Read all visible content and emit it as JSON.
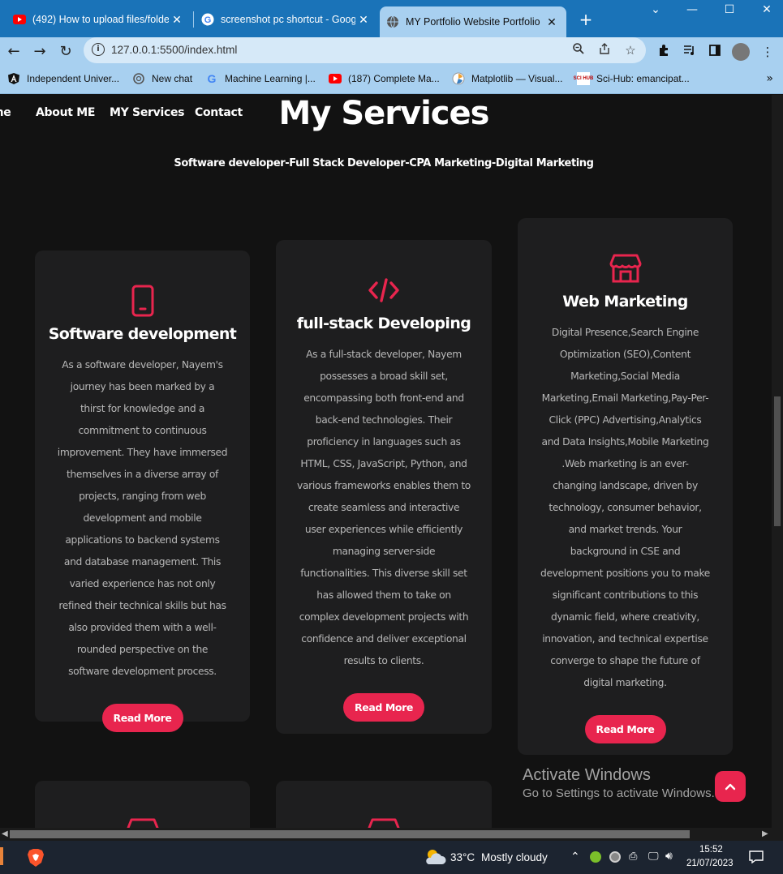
{
  "browser": {
    "tabs": [
      {
        "title": "(492) How to upload files/folder",
        "icon": "youtube-icon"
      },
      {
        "title": "screenshot pc shortcut - Google",
        "icon": "google-icon"
      },
      {
        "title": "MY Portfolio Website Portfolio",
        "icon": "globe-icon",
        "active": true
      }
    ],
    "url": "127.0.0.1:5500/index.html",
    "bookmarks": [
      {
        "label": "Independent Univer...",
        "icon": "angular-icon"
      },
      {
        "label": "New chat",
        "icon": "openai-icon"
      },
      {
        "label": "Machine Learning |...",
        "icon": "google-icon"
      },
      {
        "label": "(187) Complete Ma...",
        "icon": "youtube-icon"
      },
      {
        "label": "Matplotlib — Visual...",
        "icon": "matplotlib-icon"
      },
      {
        "label": "Sci-Hub: emancipat...",
        "icon": "scihub-icon"
      }
    ],
    "sci_hub_badge": "SCI HUB"
  },
  "nav": {
    "items": [
      "me",
      "About ME",
      "MY Services",
      "Contact"
    ]
  },
  "services": {
    "title": "My Services",
    "subtitle": "Software developer-Full Stack Developer-CPA Marketing-Digital Marketing",
    "cards": [
      {
        "icon": "mobile-icon",
        "title": "Software development",
        "text": "As a software developer, Nayem's journey has been marked by a thirst for knowledge and a commitment to continuous improvement. They have immersed themselves in a diverse array of projects, ranging from web development and mobile applications to backend systems and database management. This varied experience has not only refined their technical skills but has also provided them with a well-rounded perspective on the software development process.",
        "button": "Read More"
      },
      {
        "icon": "code-icon",
        "title": "full-stack Developing",
        "text": "As a full-stack developer, Nayem possesses a broad skill set, encompassing both front-end and back-end technologies. Their proficiency in languages such as HTML, CSS, JavaScript, Python, and various frameworks enables them to create seamless and interactive user experiences while efficiently managing server-side functionalities. This diverse skill set has allowed them to take on complex development projects with confidence and deliver exceptional results to clients.",
        "button": "Read More"
      },
      {
        "icon": "store-icon",
        "title": "Web Marketing",
        "text": "Digital Presence,Search Engine Optimization (SEO),Content Marketing,Social Media Marketing,Email Marketing,Pay-Per-Click (PPC) Advertising,Analytics and Data Insights,Mobile Marketing .Web marketing is an ever-changing landscape, driven by technology, consumer behavior, and market trends. Your background in CSE and development positions you to make significant contributions to this dynamic field, where creativity, innovation, and technical expertise converge to shape the future of digital marketing.",
        "button": "Read More"
      }
    ]
  },
  "windows": {
    "activate_title": "Activate Windows",
    "activate_sub": "Go to Settings to activate Windows."
  },
  "taskbar": {
    "weather_temp": "33°C",
    "weather_desc": "Mostly cloudy",
    "time": "15:52",
    "date": "21/07/2023"
  },
  "colors": {
    "accent": "#e8254e",
    "page_bg": "#121212",
    "card_bg": "#1e1e1f",
    "tabbar": "#1a73b8",
    "toolbar": "#a8d0f0"
  }
}
